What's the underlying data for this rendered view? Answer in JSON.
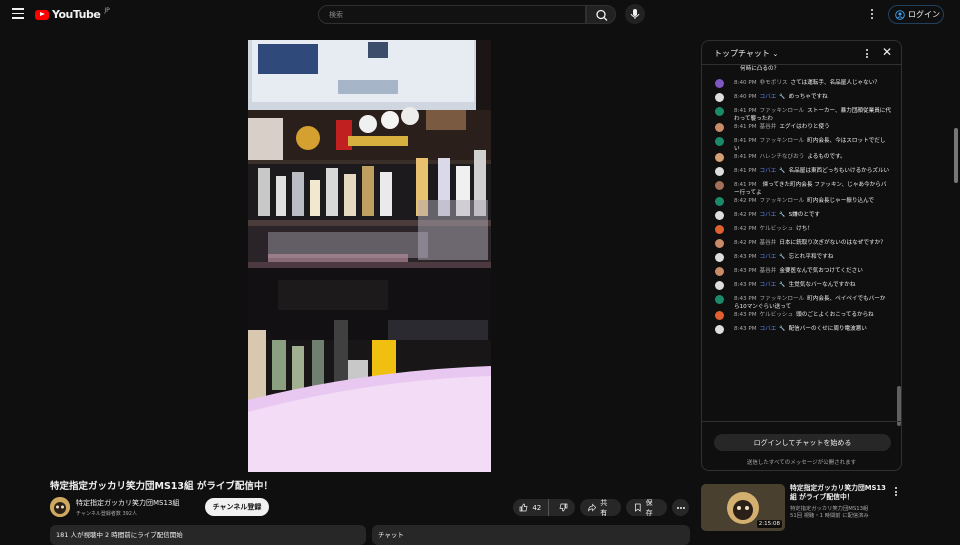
{
  "header": {
    "logo_text": "YouTube",
    "logo_sup": "JP",
    "search_placeholder": "検索",
    "login_label": "ログイン"
  },
  "video": {
    "title": "特定指定ガッカリ笑力団MS13組 がライブ配信中！",
    "channel_name": "特定指定ガッカリ笑力団MS13組",
    "channel_subs": "チャンネル登録者数 392人",
    "subscribe_label": "チャンネル登録",
    "like_count": "42",
    "share_label": "共有",
    "save_label": "保存",
    "description_summary": "181 人が視聴中 2 時間前にライブ配信開始",
    "chat_tab_label": "チャット"
  },
  "chat": {
    "header_title": "トップチャット",
    "login_button": "ログインしてチャットを始める",
    "note": "送信したすべてのメッセージが公開されます",
    "messages": [
      {
        "time": "",
        "author": "",
        "text": "何時に凸るの？",
        "avatar_color": "#00000000",
        "mod": false
      },
      {
        "time": "8:40 PM",
        "author": "非モボリス",
        "text": "さては運転手、名品屋人じゃない？",
        "avatar_color": "#7e57c2",
        "mod": false
      },
      {
        "time": "8:40 PM",
        "author": "コバエ",
        "text": "めっちゃですね",
        "avatar_color": "#dddddd",
        "mod": true
      },
      {
        "time": "8:41 PM",
        "author": "ファッキンロール",
        "text": "ストーカー、暴力団顔従業員に代わって襲ったわ",
        "avatar_color": "#1b8a6b",
        "mod": false
      },
      {
        "time": "8:41 PM",
        "author": "基谷井",
        "text": "エグイはわりと使う",
        "avatar_color": "#c98b6a",
        "mod": false
      },
      {
        "time": "8:41 PM",
        "author": "ファッキンロール",
        "text": "町内会長、今はスロットでだしい",
        "avatar_color": "#1b8a6b",
        "mod": false
      },
      {
        "time": "8:41 PM",
        "author": "ハレンチなびおう",
        "text": "よるものです。",
        "avatar_color": "#d8a070",
        "mod": false
      },
      {
        "time": "8:41 PM",
        "author": "コバエ",
        "text": "名品屋は東西どっちもいけるからズルい",
        "avatar_color": "#dddddd",
        "mod": true
      },
      {
        "time": "8:41 PM",
        "author": "",
        "text": "帰ってきた町内会長 ファッキン、じゃあ今からバー行ってよ",
        "avatar_color": "#a0705a",
        "mod": false
      },
      {
        "time": "8:42 PM",
        "author": "ファッキンロール",
        "text": "町内会長じゃー振り込んで",
        "avatar_color": "#1b8a6b",
        "mod": false
      },
      {
        "time": "8:42 PM",
        "author": "コバエ",
        "text": "S嫌のとです",
        "avatar_color": "#dddddd",
        "mod": true
      },
      {
        "time": "8:42 PM",
        "author": "ケルビッシュ",
        "text": "けち！",
        "avatar_color": "#e06030",
        "mod": false
      },
      {
        "time": "8:42 PM",
        "author": "基谷井",
        "text": "日本に銃取り次ぎがないのはなぜですか？",
        "avatar_color": "#c98b6a",
        "mod": false
      },
      {
        "time": "8:43 PM",
        "author": "コバエ",
        "text": "忘とれ平和ですね",
        "avatar_color": "#dddddd",
        "mod": true
      },
      {
        "time": "8:43 PM",
        "author": "基谷井",
        "text": "金要医なんで気おつけてください",
        "avatar_color": "#c98b6a",
        "mod": false
      },
      {
        "time": "8:43 PM",
        "author": "コバエ",
        "text": "生覚気なバーなんですかね",
        "avatar_color": "#dddddd",
        "mod": true
      },
      {
        "time": "8:43 PM",
        "author": "ファッキンロール",
        "text": "町内会長、ペイペイでもバーから10マンぐらい送って",
        "avatar_color": "#1b8a6b",
        "mod": false
      },
      {
        "time": "8:43 PM",
        "author": "ケルビッシュ",
        "text": "頭のごとよくおこってるからね",
        "avatar_color": "#e06030",
        "mod": false
      },
      {
        "time": "8:43 PM",
        "author": "コバエ",
        "text": "配信バーのくせに周り電波悪い",
        "avatar_color": "#dddddd",
        "mod": true
      }
    ]
  },
  "related": {
    "title": "特定指定ガッカリ笑力団MS13組 がライブ配信中！",
    "channel": "特定指定ガッカリ笑力団MS13組",
    "meta": "51回 視聴・1 時間前 に配信済み",
    "duration": "2:15:08"
  },
  "colors": {
    "background": "#0f0f0f",
    "accent_red": "#ff0000",
    "moderator_blue": "#5e84f1",
    "pill_bg": "#272727"
  }
}
